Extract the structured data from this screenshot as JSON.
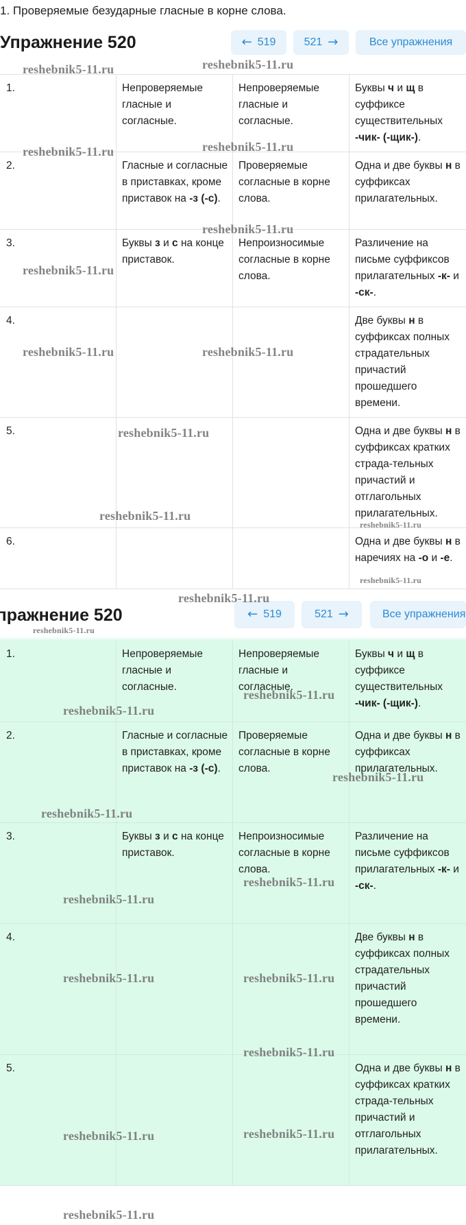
{
  "top_line": "1. Проверяемые безударные гласные в корне слова.",
  "section1": {
    "title": "Упражнение 520",
    "prev_label": "519",
    "next_label": "521",
    "all_label": "Все упражнения"
  },
  "table1": [
    {
      "c0": "1.",
      "c1": "Непроверяемые гласные и согласные.",
      "c2": "Непроверяемые гласные и согласные.",
      "c3_html": "Буквы <b>ч</b> и <b>щ</b> в суффиксе существительных <b>-чик- (-щик-)</b>."
    },
    {
      "c0": "2.",
      "c1_html": "Гласные и согласные в приставках, кроме приставок на <b>-з (-с)</b>.",
      "c2": "Проверяемые согласные в корне слова.",
      "c3_html": "Одна и две буквы <b>н</b> в суффиксах прилагательных."
    },
    {
      "c0": "3.",
      "c1_html": "Буквы <b>з</b> и <b>с</b> на конце приставок.",
      "c2": "Непроизносимые согласные в корне слова.",
      "c3_html": "Различение на письме суффиксов прилагательных <b>-к-</b> и <b>-ск-</b>."
    },
    {
      "c0": "4.",
      "c1": "",
      "c2": "",
      "c3_html": "Две буквы <b>н</b> в суффиксах полных страдательных причастий прошедшего времени."
    },
    {
      "c0": "5.",
      "c1": "",
      "c2": "",
      "c3_html": "Одна и две буквы <b>н</b> в суффиксах кратких страда-тельных причастий и отглагольных прилагательных."
    },
    {
      "c0": "6.",
      "c1": "",
      "c2": "",
      "c3_html": "Одна и две буквы <b>н</b> в наречиях на <b>-о</b> и <b>-е</b>."
    }
  ],
  "section2": {
    "title": "Упражнение 520",
    "prev_label": "519",
    "next_label": "521",
    "all_label": "Все упражнения"
  },
  "table2": [
    {
      "c0": "1.",
      "c1": "Непроверяемые гласные и согласные.",
      "c2": "Непроверяемые гласные и согласные.",
      "c3_html": "Буквы <b>ч</b> и <b>щ</b> в суффиксе существительных <b>-чик- (-щик-)</b>."
    },
    {
      "c0": "2.",
      "c1_html": "Гласные и согласные в приставках, кроме приставок на <b>-з (-с)</b>.",
      "c2": "Проверяемые согласные в корне слова.",
      "c3_html": "Одна и две буквы <b>н</b> в суффиксах прилагательных."
    },
    {
      "c0": "3.",
      "c1_html": "Буквы <b>з</b> и <b>с</b> на конце приставок.",
      "c2": "Непроизносимые согласные в корне слова.",
      "c3_html": "Различение на письме суффиксов прилагательных <b>-к-</b> и <b>-ск-</b>."
    },
    {
      "c0": "4.",
      "c1": "",
      "c2": "",
      "c3_html": "Две буквы <b>н</b> в суффиксах полных страдательных причастий прошедшего времени."
    },
    {
      "c0": "5.",
      "c1": "",
      "c2": "",
      "c3_html": "Одна и две буквы <b>н</b> в суффиксах кратких страда-тельных причастий и отглагольных прилагательных."
    }
  ],
  "watermark": "reshebnik5-11.ru",
  "icons": {
    "prev": "arrow-left-icon",
    "next": "arrow-right-icon"
  },
  "colors": {
    "nav_bg": "#e8f3fb",
    "nav_text": "#2a8bd6",
    "green_bg": "#dcfaea"
  }
}
